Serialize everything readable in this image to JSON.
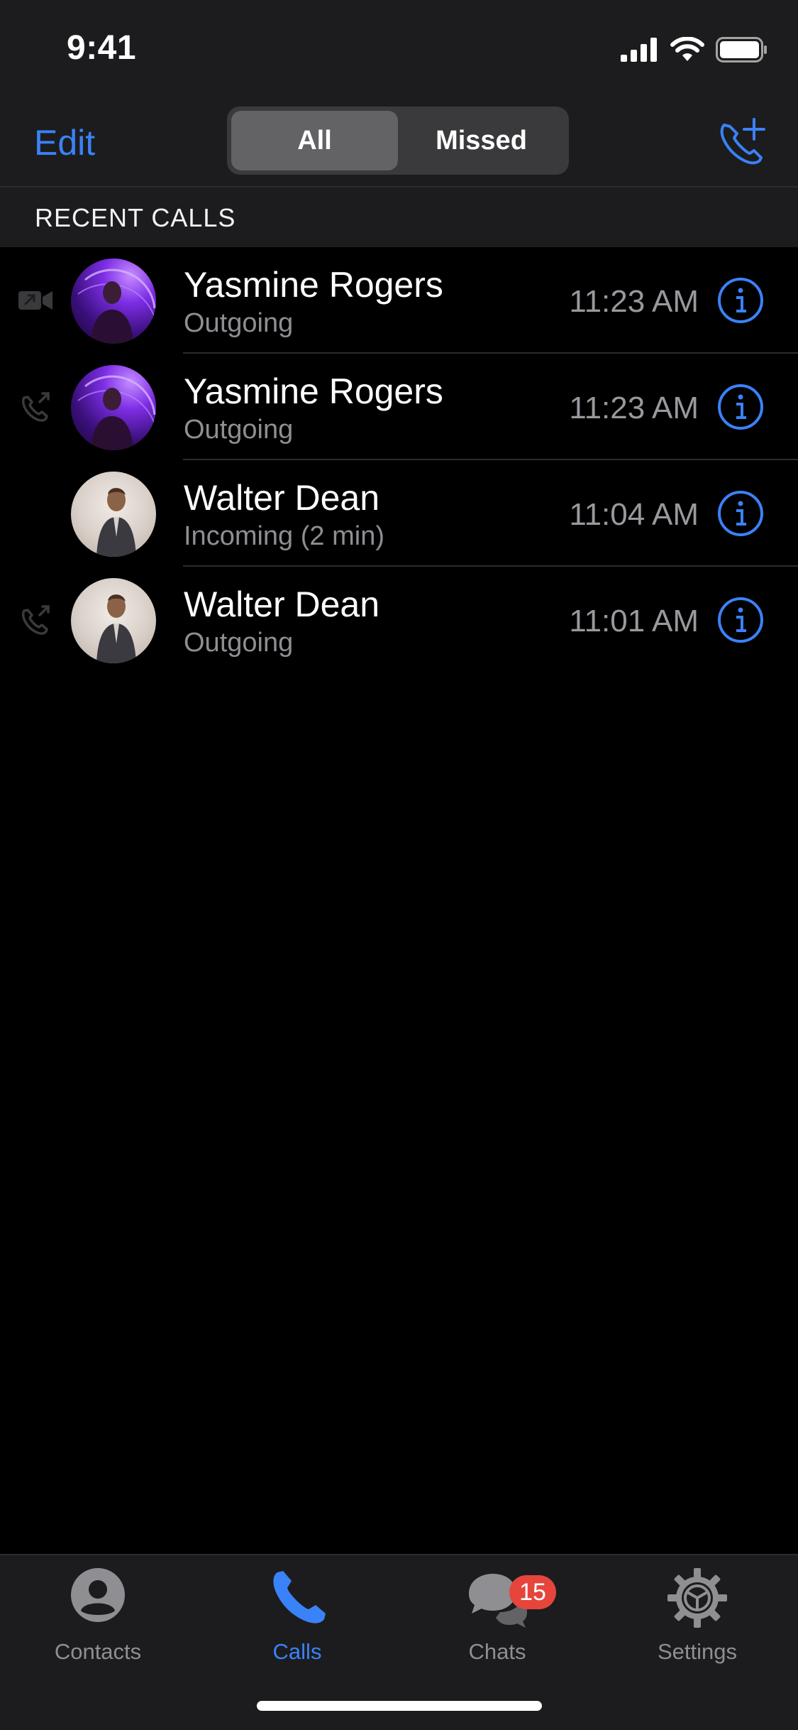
{
  "status_bar": {
    "time": "9:41",
    "icons": [
      "signal-icon",
      "wifi-icon",
      "battery-icon"
    ]
  },
  "nav": {
    "edit_label": "Edit",
    "segments": [
      {
        "label": "All",
        "active": true
      },
      {
        "label": "Missed",
        "active": false
      }
    ],
    "new_call_icon": "phone-plus-icon"
  },
  "section": {
    "title": "RECENT CALLS"
  },
  "calls": [
    {
      "name": "Yasmine Rogers",
      "status": "Outgoing",
      "time": "11:23 AM",
      "type_icon": "video-outgoing-icon"
    },
    {
      "name": "Yasmine Rogers",
      "status": "Outgoing",
      "time": "11:23 AM",
      "type_icon": "phone-outgoing-icon"
    },
    {
      "name": "Walter Dean",
      "status": "Incoming (2 min)",
      "time": "11:04 AM",
      "type_icon": ""
    },
    {
      "name": "Walter Dean",
      "status": "Outgoing",
      "time": "11:01 AM",
      "type_icon": "phone-outgoing-icon"
    }
  ],
  "tabs": [
    {
      "label": "Contacts",
      "icon": "person-icon",
      "active": false
    },
    {
      "label": "Calls",
      "icon": "phone-icon",
      "active": true
    },
    {
      "label": "Chats",
      "icon": "chat-bubbles-icon",
      "active": false,
      "badge": "15"
    },
    {
      "label": "Settings",
      "icon": "gear-icon",
      "active": false
    }
  ],
  "colors": {
    "accent": "#3a82f7",
    "badge": "#e5453b",
    "background": "#000000",
    "bar": "#1c1c1e"
  }
}
